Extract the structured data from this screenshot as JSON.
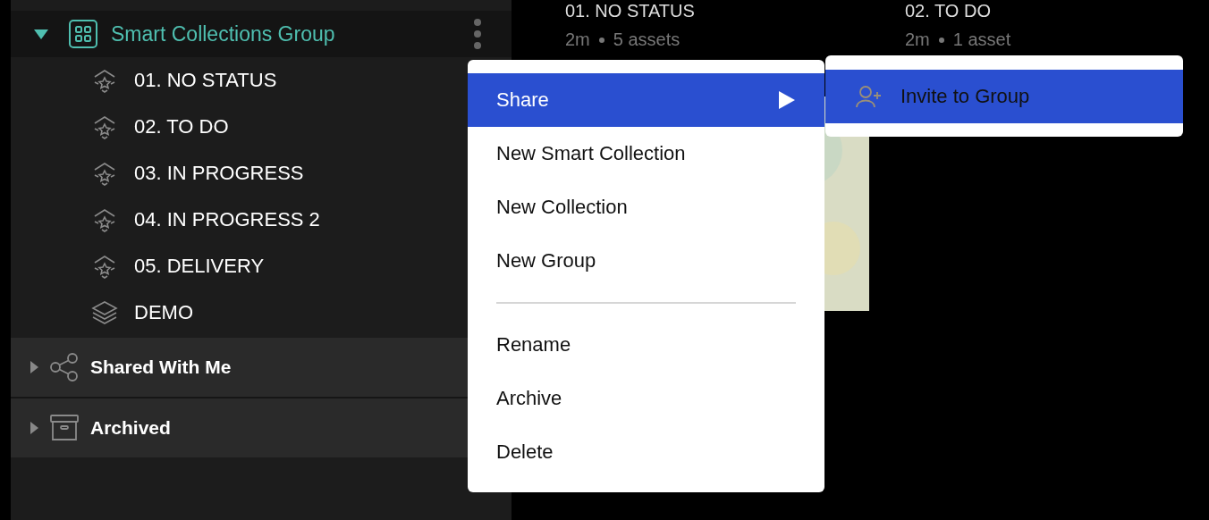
{
  "sidebar": {
    "group": {
      "label": "Smart Collections Group",
      "expanded": true,
      "items": [
        {
          "label": "01. NO STATUS",
          "kind": "smart"
        },
        {
          "label": "02. TO DO",
          "kind": "smart"
        },
        {
          "label": "03. IN PROGRESS",
          "kind": "smart"
        },
        {
          "label": "04. IN PROGRESS 2",
          "kind": "smart"
        },
        {
          "label": "05. DELIVERY",
          "kind": "smart"
        },
        {
          "label": "DEMO",
          "kind": "collection"
        }
      ]
    },
    "sections": [
      {
        "label": "Shared With Me",
        "kind": "shared",
        "expanded": false
      },
      {
        "label": "Archived",
        "kind": "archive",
        "expanded": false
      }
    ]
  },
  "cards": [
    {
      "title": "01. NO STATUS",
      "age": "2m",
      "count": "5 assets"
    },
    {
      "title": "02. TO DO",
      "age": "2m",
      "count": "1 asset"
    }
  ],
  "context_menu": {
    "groups": [
      [
        {
          "label": "Share",
          "selected": true,
          "submenu": true
        },
        {
          "label": "New Smart Collection",
          "selected": false,
          "submenu": false
        },
        {
          "label": "New Collection",
          "selected": false,
          "submenu": false
        },
        {
          "label": "New Group",
          "selected": false,
          "submenu": false
        }
      ],
      [
        {
          "label": "Rename",
          "selected": false,
          "submenu": false
        },
        {
          "label": "Archive",
          "selected": false,
          "submenu": false
        },
        {
          "label": "Delete",
          "selected": false,
          "submenu": false
        }
      ]
    ],
    "submenu": [
      {
        "label": "Invite to Group",
        "selected": true
      }
    ]
  }
}
